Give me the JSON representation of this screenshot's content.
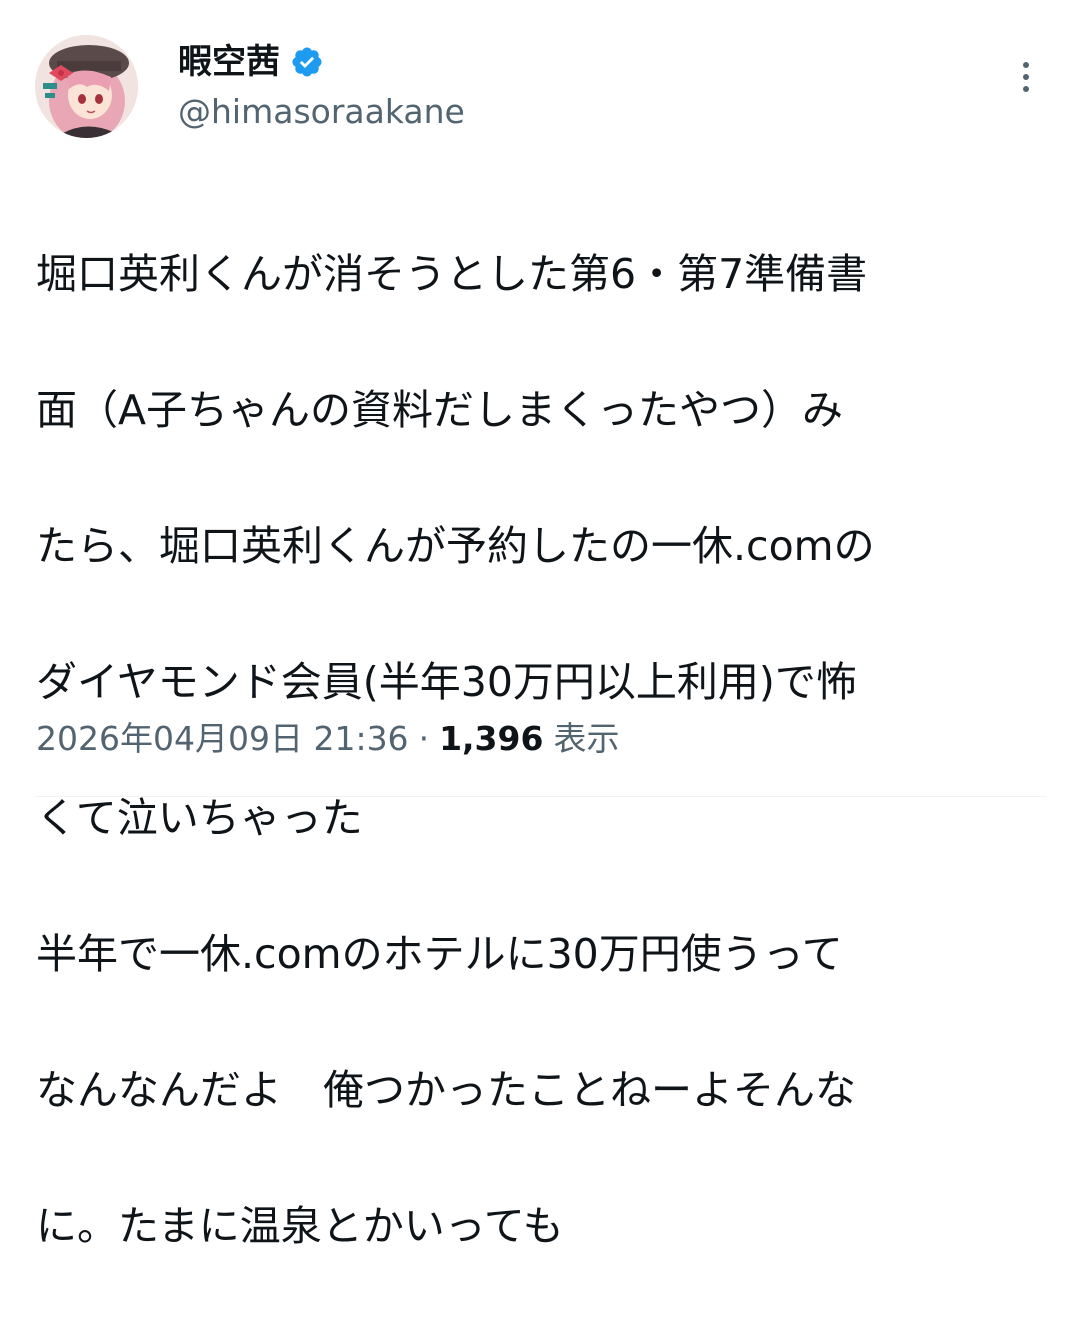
{
  "author": {
    "display_name": "暇空茜",
    "handle": "@himasoraakane",
    "verified": true,
    "avatar": "anime-girl-avatar"
  },
  "tweet": {
    "lines": [
      "堀口英利くんが消そうとした第6・第7準備書",
      "面（A子ちゃんの資料だしまくったやつ）み",
      "たら、堀口英利くんが予約したの一休.comの",
      "ダイヤモンド会員(半年30万円以上利用)で怖",
      "くて泣いちゃった",
      "半年で一休.comのホテルに30万円使うって",
      "なんなんだよ　俺つかったことねーよそんな",
      "に。たまに温泉とかいっても"
    ]
  },
  "meta": {
    "timestamp": "2026年04月09日 21:36",
    "separator": "·",
    "views_count": "1,396",
    "views_label": "表示"
  },
  "colors": {
    "text": "#0f1419",
    "secondary": "#536471",
    "verified": "#1d9bf0",
    "divider": "#eff3f4"
  },
  "icons": {
    "verified": "verified-badge-icon",
    "more": "more-vertical-icon"
  }
}
